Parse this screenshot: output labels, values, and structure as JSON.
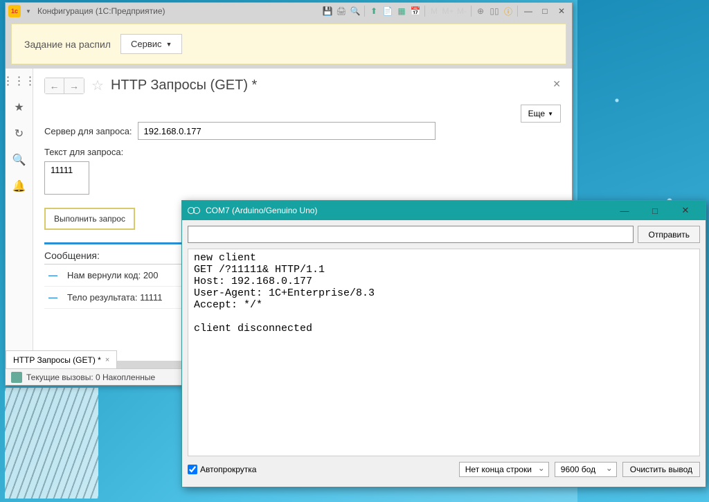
{
  "window1c": {
    "title": "Конфигурация  (1С:Предприятие)",
    "yellowHeader": "Задание на распил",
    "serviceBtn": "Сервис",
    "pageTitle": "HTTP Запросы (GET) *",
    "moreBtn": "Еще",
    "serverLabel": "Сервер для запроса:",
    "serverValue": "192.168.0.177",
    "textLabel": "Текст для запроса:",
    "textValue": "11111",
    "executeBtn": "Выполнить запрос",
    "messagesLabel": "Сообщения:",
    "messages": [
      "Нам вернули код: 200",
      "Тело результата: 11111"
    ],
    "tabLabel": "HTTP Запросы (GET) *",
    "statusText": "Текущие вызовы: 0  Накопленные"
  },
  "arduino": {
    "title": "COM7 (Arduino/Genuino Uno)",
    "sendBtn": "Отправить",
    "output": "new client\nGET /?11111& HTTP/1.1\nHost: 192.168.0.177\nUser-Agent: 1C+Enterprise/8.3\nAccept: */*\n\nclient disconnected",
    "autoscroll": "Автопрокрутка",
    "lineEnding": "Нет конца строки",
    "baudRate": "9600 бод",
    "clearBtn": "Очистить вывод"
  }
}
